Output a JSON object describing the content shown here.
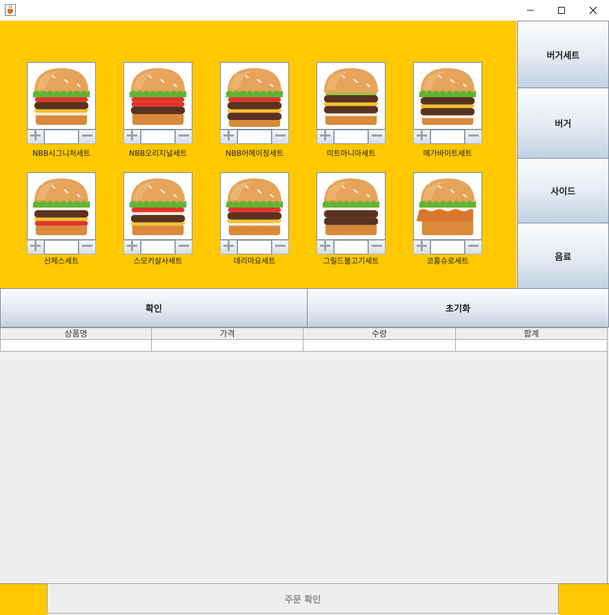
{
  "window": {
    "title": "",
    "icon": "java-cup-icon",
    "controls": [
      "minimize-icon",
      "maximize-icon",
      "close-icon"
    ]
  },
  "menu": {
    "background": "#ffc800",
    "items": [
      {
        "name": "NBB시그니처세트",
        "qty": "",
        "image": "burger-image",
        "style": "classic"
      },
      {
        "name": "NBB오리지널세트",
        "qty": "",
        "image": "burger-image",
        "style": "tomato"
      },
      {
        "name": "NBB어메이징세트",
        "qty": "",
        "image": "burger-image",
        "style": "double"
      },
      {
        "name": "미트마니아세트",
        "qty": "",
        "image": "burger-image",
        "style": "pickle"
      },
      {
        "name": "메가바이트세트",
        "qty": "",
        "image": "burger-image",
        "style": "mega"
      },
      {
        "name": "산체스세트",
        "qty": "",
        "image": "burger-image",
        "style": "spicy"
      },
      {
        "name": "스모키살사세트",
        "qty": "",
        "image": "burger-image",
        "style": "salsa"
      },
      {
        "name": "데리마요세트",
        "qty": "",
        "image": "burger-image",
        "style": "classic"
      },
      {
        "name": "그릴드불고기세트",
        "qty": "",
        "image": "burger-image",
        "style": "bulgogi"
      },
      {
        "name": "코홍슈로세트",
        "qty": "",
        "image": "burger-image",
        "style": "chicken"
      }
    ]
  },
  "categories": [
    {
      "label": "버거세트"
    },
    {
      "label": "버거"
    },
    {
      "label": "사이드"
    },
    {
      "label": "음료"
    }
  ],
  "actions": {
    "confirm": "확인",
    "reset": "초기화"
  },
  "table": {
    "columns": [
      "상품명",
      "가격",
      "수량",
      "합계"
    ],
    "rows": [
      [
        "",
        "",
        "",
        ""
      ]
    ]
  },
  "footer": {
    "order_confirm": "주문 확인"
  }
}
